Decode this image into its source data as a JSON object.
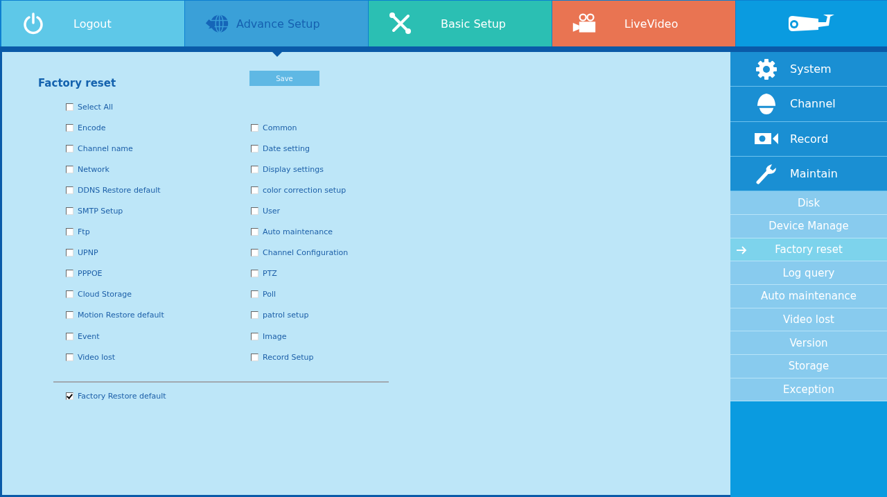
{
  "tabs": [
    {
      "label": "Logout",
      "kind": "power",
      "color": "#5ec8e8",
      "selected": false
    },
    {
      "label": "Advance Setup",
      "kind": "globe",
      "color": "#3aa0d8",
      "selected": true
    },
    {
      "label": "Basic Setup",
      "kind": "tools",
      "color": "#2bbfb3",
      "selected": false
    },
    {
      "label": "LiveVideo",
      "kind": "camera",
      "color": "#e97452",
      "selected": false
    }
  ],
  "content": {
    "title": "Factory reset",
    "save_button": "Save",
    "select_all": {
      "label": "Select All",
      "checked": false
    },
    "options": [
      [
        {
          "label": "Encode",
          "checked": false
        },
        {
          "label": "Common",
          "checked": false
        }
      ],
      [
        {
          "label": "Channel name",
          "checked": false
        },
        {
          "label": "Date setting",
          "checked": false
        }
      ],
      [
        {
          "label": "Network",
          "checked": false
        },
        {
          "label": "Display settings",
          "checked": false
        }
      ],
      [
        {
          "label": "DDNS Restore default",
          "checked": false
        },
        {
          "label": "color correction setup",
          "checked": false
        }
      ],
      [
        {
          "label": "SMTP Setup",
          "checked": false
        },
        {
          "label": "User",
          "checked": false
        }
      ],
      [
        {
          "label": "Ftp",
          "checked": false
        },
        {
          "label": "Auto maintenance",
          "checked": false
        }
      ],
      [
        {
          "label": "UPNP",
          "checked": false
        },
        {
          "label": "Channel Configuration",
          "checked": false
        }
      ],
      [
        {
          "label": "PPPOE",
          "checked": false
        },
        {
          "label": "PTZ",
          "checked": false
        }
      ],
      [
        {
          "label": "Cloud Storage",
          "checked": false
        },
        {
          "label": "Poll",
          "checked": false
        }
      ],
      [
        {
          "label": "Motion Restore default",
          "checked": false
        },
        {
          "label": "patrol setup",
          "checked": false
        }
      ],
      [
        {
          "label": "Event",
          "checked": false
        },
        {
          "label": "Image",
          "checked": false
        }
      ],
      [
        {
          "label": "Video lost",
          "checked": false
        },
        {
          "label": "Record Setup",
          "checked": false
        }
      ]
    ],
    "factory_restore": {
      "label": "Factory Restore default",
      "checked": true
    }
  },
  "sidebar": {
    "sections": [
      {
        "label": "System",
        "kind": "gear"
      },
      {
        "label": "Channel",
        "kind": "dome"
      },
      {
        "label": "Record",
        "kind": "record"
      },
      {
        "label": "Maintain",
        "kind": "wrench"
      }
    ],
    "items": [
      {
        "label": "Disk",
        "selected": false
      },
      {
        "label": "Device Manage",
        "selected": false
      },
      {
        "label": "Factory reset",
        "selected": true
      },
      {
        "label": "Log query",
        "selected": false
      },
      {
        "label": "Auto maintenance",
        "selected": false
      },
      {
        "label": "Video lost",
        "selected": false
      },
      {
        "label": "Version",
        "selected": false
      },
      {
        "label": "Storage",
        "selected": false
      },
      {
        "label": "Exception",
        "selected": false
      }
    ]
  }
}
